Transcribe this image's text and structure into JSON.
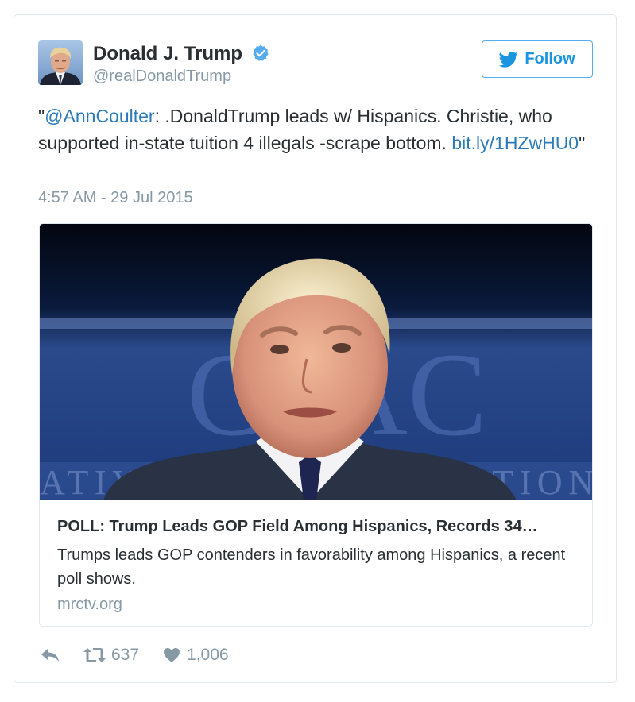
{
  "tweet": {
    "author_name": "Donald J. Trump",
    "author_handle": "@realDonaldTrump",
    "verified_icon": "verified-badge-icon",
    "follow_label": "Follow",
    "text_open_quote": "\"",
    "mention": "@AnnCoulter",
    "text_body": ": .DonaldTrump leads w/ Hispanics. Christie, who supported in-state tuition 4 illegals -scrape bottom. ",
    "link": "bit.ly/1HZwHU0",
    "text_close_quote": "\"",
    "timestamp": "4:57 AM - 29 Jul 2015"
  },
  "card": {
    "title": "POLL: Trump Leads GOP Field Among Hispanics, Records 34…",
    "description": "Trumps leads GOP contenders in favorability among Hispanics, a recent poll shows.",
    "domain": "mrctv.org",
    "photo_backdrop_text": "CPAC",
    "photo_banner_text": "ATIVE POLITICAL ACTION"
  },
  "actions": {
    "reply_icon": "reply-icon",
    "retweet_icon": "retweet-icon",
    "retweet_count": "637",
    "like_icon": "heart-icon",
    "like_count": "1,006"
  },
  "colors": {
    "link_blue": "#2b7bb9",
    "follow_blue": "#1b95e0",
    "muted_gray": "#8899a6",
    "text_dark": "#292f33",
    "border": "#e1e8ed"
  }
}
